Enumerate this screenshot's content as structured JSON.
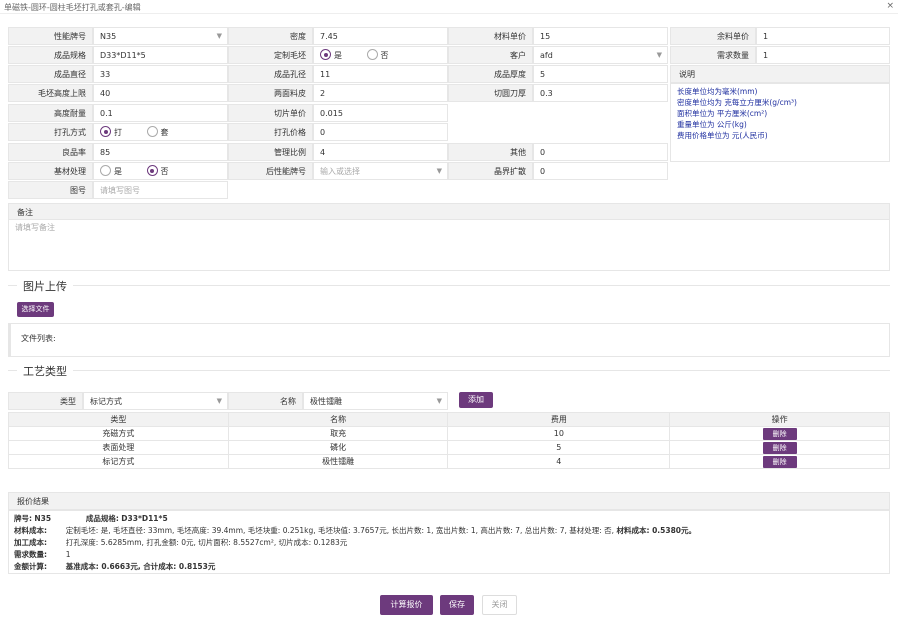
{
  "window": {
    "title": "单磁铁-圆环-圆柱毛坯打孔或套孔-编辑",
    "close": "×"
  },
  "form": {
    "perf_grade": {
      "label": "性能牌号",
      "value": "N35"
    },
    "density": {
      "label": "密度",
      "value": "7.45"
    },
    "material_price": {
      "label": "材料单价",
      "value": "15"
    },
    "scrap_price": {
      "label": "余料单价",
      "value": "1"
    },
    "spec": {
      "label": "成品规格",
      "value": "D33*D11*5"
    },
    "custom_blank": {
      "label": "定制毛坯",
      "yes": "是",
      "no": "否"
    },
    "customer": {
      "label": "客户",
      "value": "afd"
    },
    "demand_qty": {
      "label": "需求数量",
      "value": "1"
    },
    "outer_dia": {
      "label": "成品直径",
      "value": "33"
    },
    "hole_dia": {
      "label": "成品孔径",
      "value": "11"
    },
    "thickness": {
      "label": "成品厚度",
      "value": "5"
    },
    "blank_height": {
      "label": "毛坯高度上限",
      "value": "40"
    },
    "double_allow": {
      "label": "两面料皮",
      "value": "2"
    },
    "kerf": {
      "label": "切圆刀厚",
      "value": "0.3"
    },
    "height_tol": {
      "label": "高度耐量",
      "value": "0.1"
    },
    "cut_price": {
      "label": "切片单价",
      "value": "0.015"
    },
    "hole_method": {
      "label": "打孔方式",
      "opt1": "打",
      "opt2": "套"
    },
    "hole_price": {
      "label": "打孔价格",
      "value": "0"
    },
    "yield": {
      "label": "良品率",
      "value": "85"
    },
    "mgmt_ratio": {
      "label": "管理比例",
      "value": "4"
    },
    "other": {
      "label": "其他",
      "value": "0"
    },
    "base_treat": {
      "label": "基材处理",
      "yes": "是",
      "no": "否"
    },
    "post_grade": {
      "label": "后性能牌号",
      "placeholder": "输入或选择"
    },
    "edge_expand": {
      "label": "晶界扩散",
      "value": "0"
    },
    "drawing": {
      "label": "图号",
      "placeholder": "请填写图号"
    },
    "notes": {
      "label": "备注",
      "placeholder": "请填写备注"
    }
  },
  "explain": {
    "label": "说明",
    "lines": [
      "长度单位均为毫米(mm)",
      "密度单位均为 克每立方厘米(g/cm³)",
      "面积单位为 平方厘米(cm²)",
      "重量单位为 公斤(kg)",
      "费用价格单位为 元(人民币)"
    ]
  },
  "upload": {
    "section": "图片上传",
    "button": "选择文件",
    "file_list": "文件列表:"
  },
  "process": {
    "section": "工艺类型",
    "type_label": "类型",
    "type_value": "标记方式",
    "name_label": "名称",
    "name_value": "极性镭雕",
    "add_button": "添加",
    "columns": [
      "类型",
      "名称",
      "费用",
      "操作"
    ],
    "rows": [
      {
        "type": "充磁方式",
        "name": "取充",
        "fee": "10",
        "action": "删除"
      },
      {
        "type": "表面处理",
        "name": "磷化",
        "fee": "5",
        "action": "删除"
      },
      {
        "type": "标记方式",
        "name": "极性镭雕",
        "fee": "4",
        "action": "删除"
      }
    ]
  },
  "result": {
    "label": "报价结果",
    "grade_k": "牌号:",
    "grade_v": "N35",
    "spec_k": "成品规格:",
    "spec_v": "D33*D11*5",
    "mat_k": "材料成本:",
    "mat_v": "定制毛坯: 是, 毛坯直径: 33mm, 毛坯高度: 39.4mm, 毛坯块重: 0.251kg, 毛坯块值: 3.7657元, 长出片数: 1, 宽出片数: 1, 高出片数: 7, 总出片数: 7, 基材处理: 否,",
    "mat_total": "材料成本: 0.5380元。",
    "proc_k": "加工成本:",
    "proc_v": "打孔深度: 5.6285mm, 打孔金额: 0元, 切片面积: 8.5527cm², 切片成本: 0.1283元",
    "qty_k": "需求数量:",
    "qty_v": "1",
    "calc_k": "金额计算:",
    "calc_v": "基准成本: 0.6663元, 合计成本: 0.8153元"
  },
  "footer": {
    "calc": "计算报价",
    "save": "保存",
    "close": "关闭"
  },
  "colors": {
    "accent": "#6d3a7d",
    "note_text": "#2030a0"
  }
}
